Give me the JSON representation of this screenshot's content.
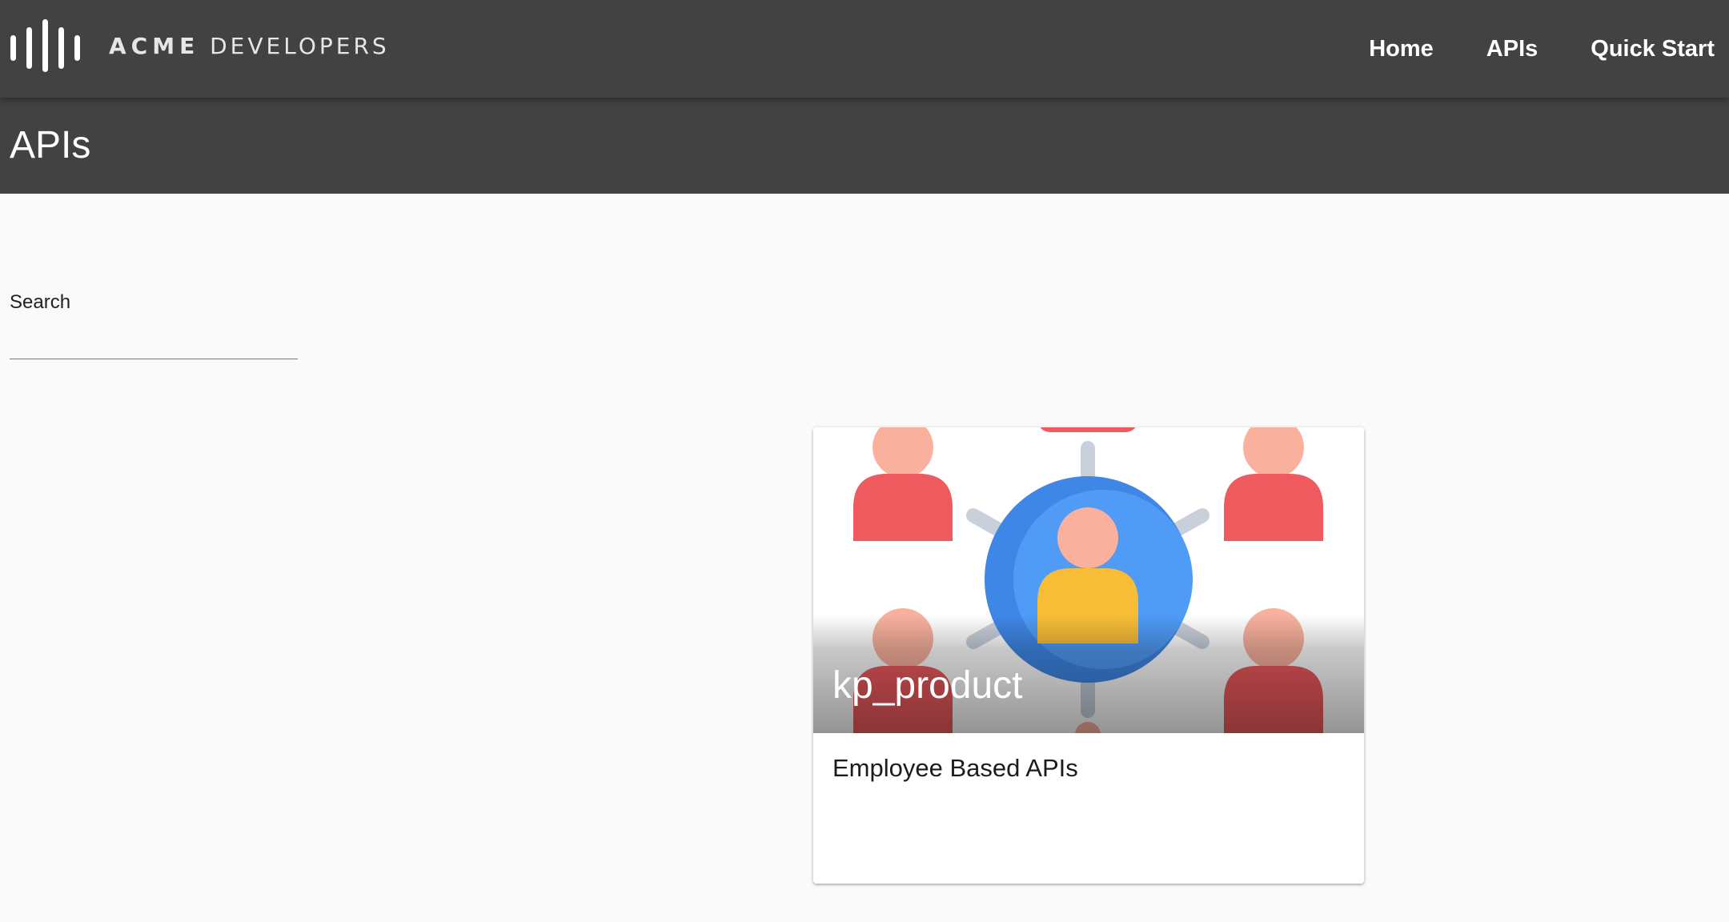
{
  "brand": {
    "name_bold": "ACME",
    "name_rest": "DEVELOPERS",
    "icon": "audio-bars-logo"
  },
  "nav": {
    "items": [
      {
        "label": "Home"
      },
      {
        "label": "APIs"
      },
      {
        "label": "Quick Start"
      }
    ]
  },
  "page": {
    "title": "APIs"
  },
  "search": {
    "label": "Search",
    "value": ""
  },
  "cards": [
    {
      "title": "kp_product",
      "description": "Employee Based APIs",
      "image_icon": "people-network-icon"
    }
  ],
  "colors": {
    "header_bg": "#424242",
    "page_bg": "#fafafa",
    "person_red": "#ee5a5e",
    "person_skin": "#f9b19e",
    "center_blue": "#4a97f4",
    "center_person": "#f7bd37",
    "spoke_gray": "#c8d0dc"
  }
}
